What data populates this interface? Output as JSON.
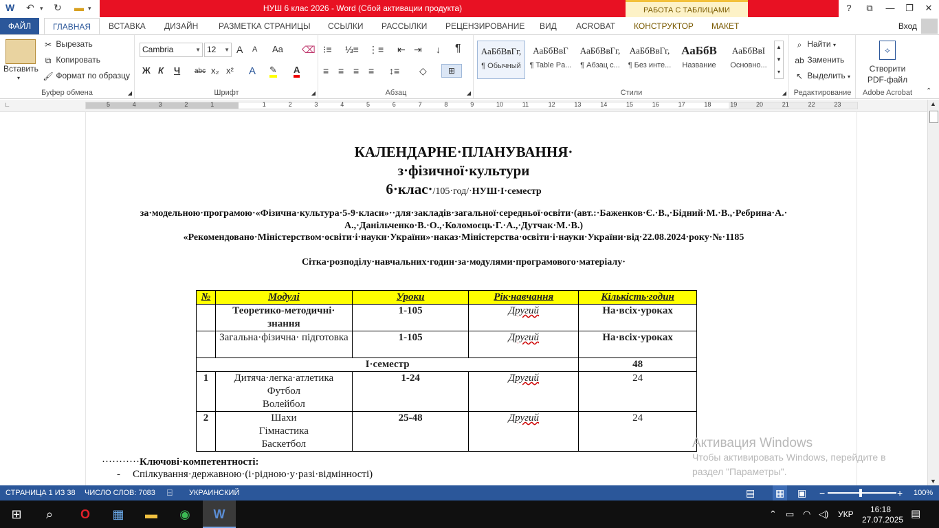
{
  "titlebar": {
    "title": "НУШ 6 клас 2026 -  Word (Сбой активации продукта)",
    "contextual_tab": "РАБОТА С ТАБЛИЦАМИ",
    "help": "?"
  },
  "tabs": {
    "file": "ФАЙЛ",
    "items": [
      "ГЛАВНАЯ",
      "ВСТАВКА",
      "ДИЗАЙН",
      "РАЗМЕТКА СТРАНИЦЫ",
      "ССЫЛКИ",
      "РАССЫЛКИ",
      "РЕЦЕНЗИРОВАНИЕ",
      "ВИД",
      "ACROBAT",
      "КОНСТРУКТОР",
      "МАКЕТ"
    ],
    "login": "Вход"
  },
  "ribbon": {
    "clipboard": {
      "paste": "Вставить",
      "cut": "Вырезать",
      "copy": "Копировать",
      "format_painter": "Формат по образцу",
      "label": "Буфер обмена"
    },
    "font": {
      "name": "Cambria",
      "size": "12",
      "label": "Шрифт",
      "bold": "Ж",
      "italic": "К",
      "underline": "Ч",
      "strike": "abc",
      "sub": "x₂",
      "sup": "x²",
      "grow": "A",
      "shrink": "A",
      "case": "Aa"
    },
    "paragraph": {
      "label": "Абзац"
    },
    "styles": {
      "label": "Стили",
      "items": [
        {
          "preview": "АаБбВвГг,",
          "name": "¶ Обычный"
        },
        {
          "preview": "АаБбВвГ",
          "name": "¶ Table Pa..."
        },
        {
          "preview": "АаБбВвГг,",
          "name": "¶ Абзац с..."
        },
        {
          "preview": "АаБбВвГг,",
          "name": "¶ Без инте..."
        },
        {
          "preview": "АаБбВ",
          "name": "Название"
        },
        {
          "preview": "АаБбВвІ",
          "name": "Основно..."
        }
      ]
    },
    "editing": {
      "find": "Найти",
      "replace": "Заменить",
      "select": "Выделить",
      "label": "Редактирование"
    },
    "acrobat": {
      "create": "Створити",
      "pdf": "PDF-файл",
      "label": "Adobe Acrobat"
    }
  },
  "ruler": {
    "left": [
      "5",
      "4",
      "3",
      "2",
      "1"
    ],
    "right": [
      "1",
      "2",
      "3",
      "4",
      "5",
      "6",
      "7",
      "8",
      "9",
      "10",
      "11",
      "12",
      "13",
      "14",
      "15",
      "16",
      "17",
      "18",
      "19",
      "20",
      "21",
      "22",
      "23"
    ]
  },
  "document": {
    "title1": "КАЛЕНДАРНЕ·ПЛАНУВАННЯ·",
    "title2": "з·фізичної·культури",
    "title3_big": "6·клас·",
    "title3_small": "/105·год/·",
    "title3_tail": "НУШ·І·семестр",
    "program1": "за·модельною·програмою·«Фізична·культура·5-9·класи»··для·закладів·загальної·середньої·освіти·(авт.:·Баженков·Є.·В.,·Бідний·М.·В.,·Ребрина·А.·",
    "program2": "А.,·Данільченко·В.·О.,·Коломоєць·Г.·А.,·Дутчак·М.·В.)",
    "program3": "«Рекомендовано·Міністерством·освіти·і·науки·України»·наказ·Міністерства·освіти·і·науки·України·від·22.08.2024·року·№·1185",
    "grid_title": "Сітка·розподілу·навчальних·годин·за·модулями·програмового·матеріалу·",
    "table": {
      "headers": [
        "№",
        "Модулі",
        "Уроки",
        "Рік·навчання",
        "Кількість·годин"
      ],
      "row1": {
        "module": "Теоретико-методичні· знання",
        "lessons": "1-105",
        "year": "Другий",
        "hours": "На·всіх·уроках"
      },
      "row2": {
        "module": "Загальна·фізична· підготовка",
        "lessons": "1-105",
        "year": "Другий",
        "hours": "На·всіх·уроках"
      },
      "semester": {
        "label": "І·семестр",
        "hours": "48"
      },
      "row3": {
        "num": "1",
        "m1": "Дитяча·легка·атлетика",
        "m2": "Футбол",
        "m3": "Волейбол",
        "lessons": "1-24",
        "year": "Другий",
        "hours": "24"
      },
      "row4": {
        "num": "2",
        "m1": "Шахи",
        "m2": "Гімнастика",
        "m3": "Баскетбол",
        "lessons": "25-48",
        "year": "Другий",
        "hours": "24"
      }
    },
    "key_comp": "Ключові·компетентності:",
    "bullet1": "Спілкування·державною·(і·рідною·у·разі·відмінності)",
    "watermark": {
      "l1": "Активация Windows",
      "l2": "Чтобы активировать Windows, перейдите в",
      "l3": "раздел \"Параметры\"."
    }
  },
  "status": {
    "page": "СТРАНИЦА 1 ИЗ 38",
    "words": "ЧИСЛО СЛОВ: 7083",
    "lang": "УКРАИНСКИЙ",
    "zoom": "100%"
  },
  "taskbar": {
    "lang": "УКР",
    "time": "16:18",
    "date": "27.07.2025"
  }
}
